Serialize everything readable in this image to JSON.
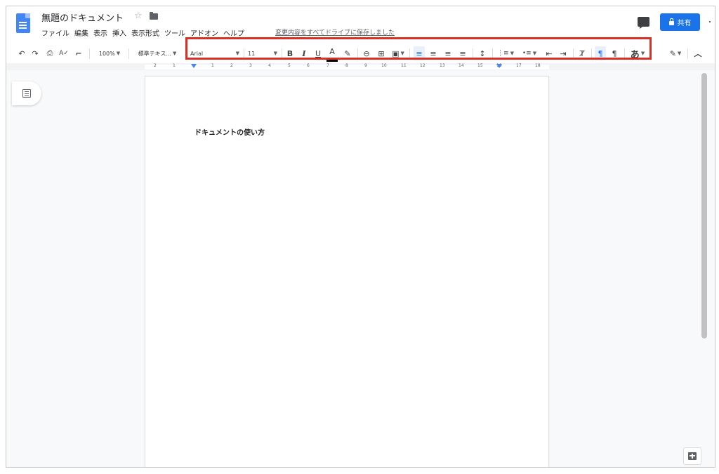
{
  "header": {
    "title": "無題のドキュメント",
    "star": "☆",
    "saved_status": "変更内容をすべてドライブに保存しました",
    "share_label": "共有",
    "menu": [
      "ファイル",
      "編集",
      "表示",
      "挿入",
      "表示形式",
      "ツール",
      "アドオン",
      "ヘルプ"
    ]
  },
  "toolbar": {
    "undo": "↶",
    "redo": "↷",
    "print": "⎙",
    "spellcheck": "A✓",
    "paint_format": "⌐",
    "zoom": "100%",
    "style": "標準テキス...",
    "font": "Arial",
    "font_size": "11",
    "bold": "B",
    "italic": "I",
    "underline": "U",
    "text_color": "A",
    "highlight": "✎",
    "link": "⊖",
    "comment": "⊞",
    "image": "▣",
    "align_left": "≡",
    "align_center": "≡",
    "align_right": "≡",
    "align_justify": "≡",
    "line_spacing": "↕",
    "numbered_list": "⋮≡",
    "bulleted_list": "•≡",
    "decrease_indent": "⇤",
    "increase_indent": "⇥",
    "clear_format": "Ⱦ",
    "ltr": "¶",
    "rtl": "¶",
    "input_tools": "あ",
    "edit_mode": "✎",
    "collapse": "︿"
  },
  "ruler": {
    "numbers": [
      "2",
      "1",
      "1",
      "2",
      "3",
      "4",
      "5",
      "6",
      "7",
      "8",
      "9",
      "10",
      "11",
      "12",
      "13",
      "14",
      "15",
      "16",
      "17",
      "18"
    ]
  },
  "document": {
    "heading": "ドキュメントの使い方"
  },
  "colors": {
    "accent": "#1a73e8",
    "highlight_box": "#d93025",
    "doc_icon": "#4285f4"
  }
}
